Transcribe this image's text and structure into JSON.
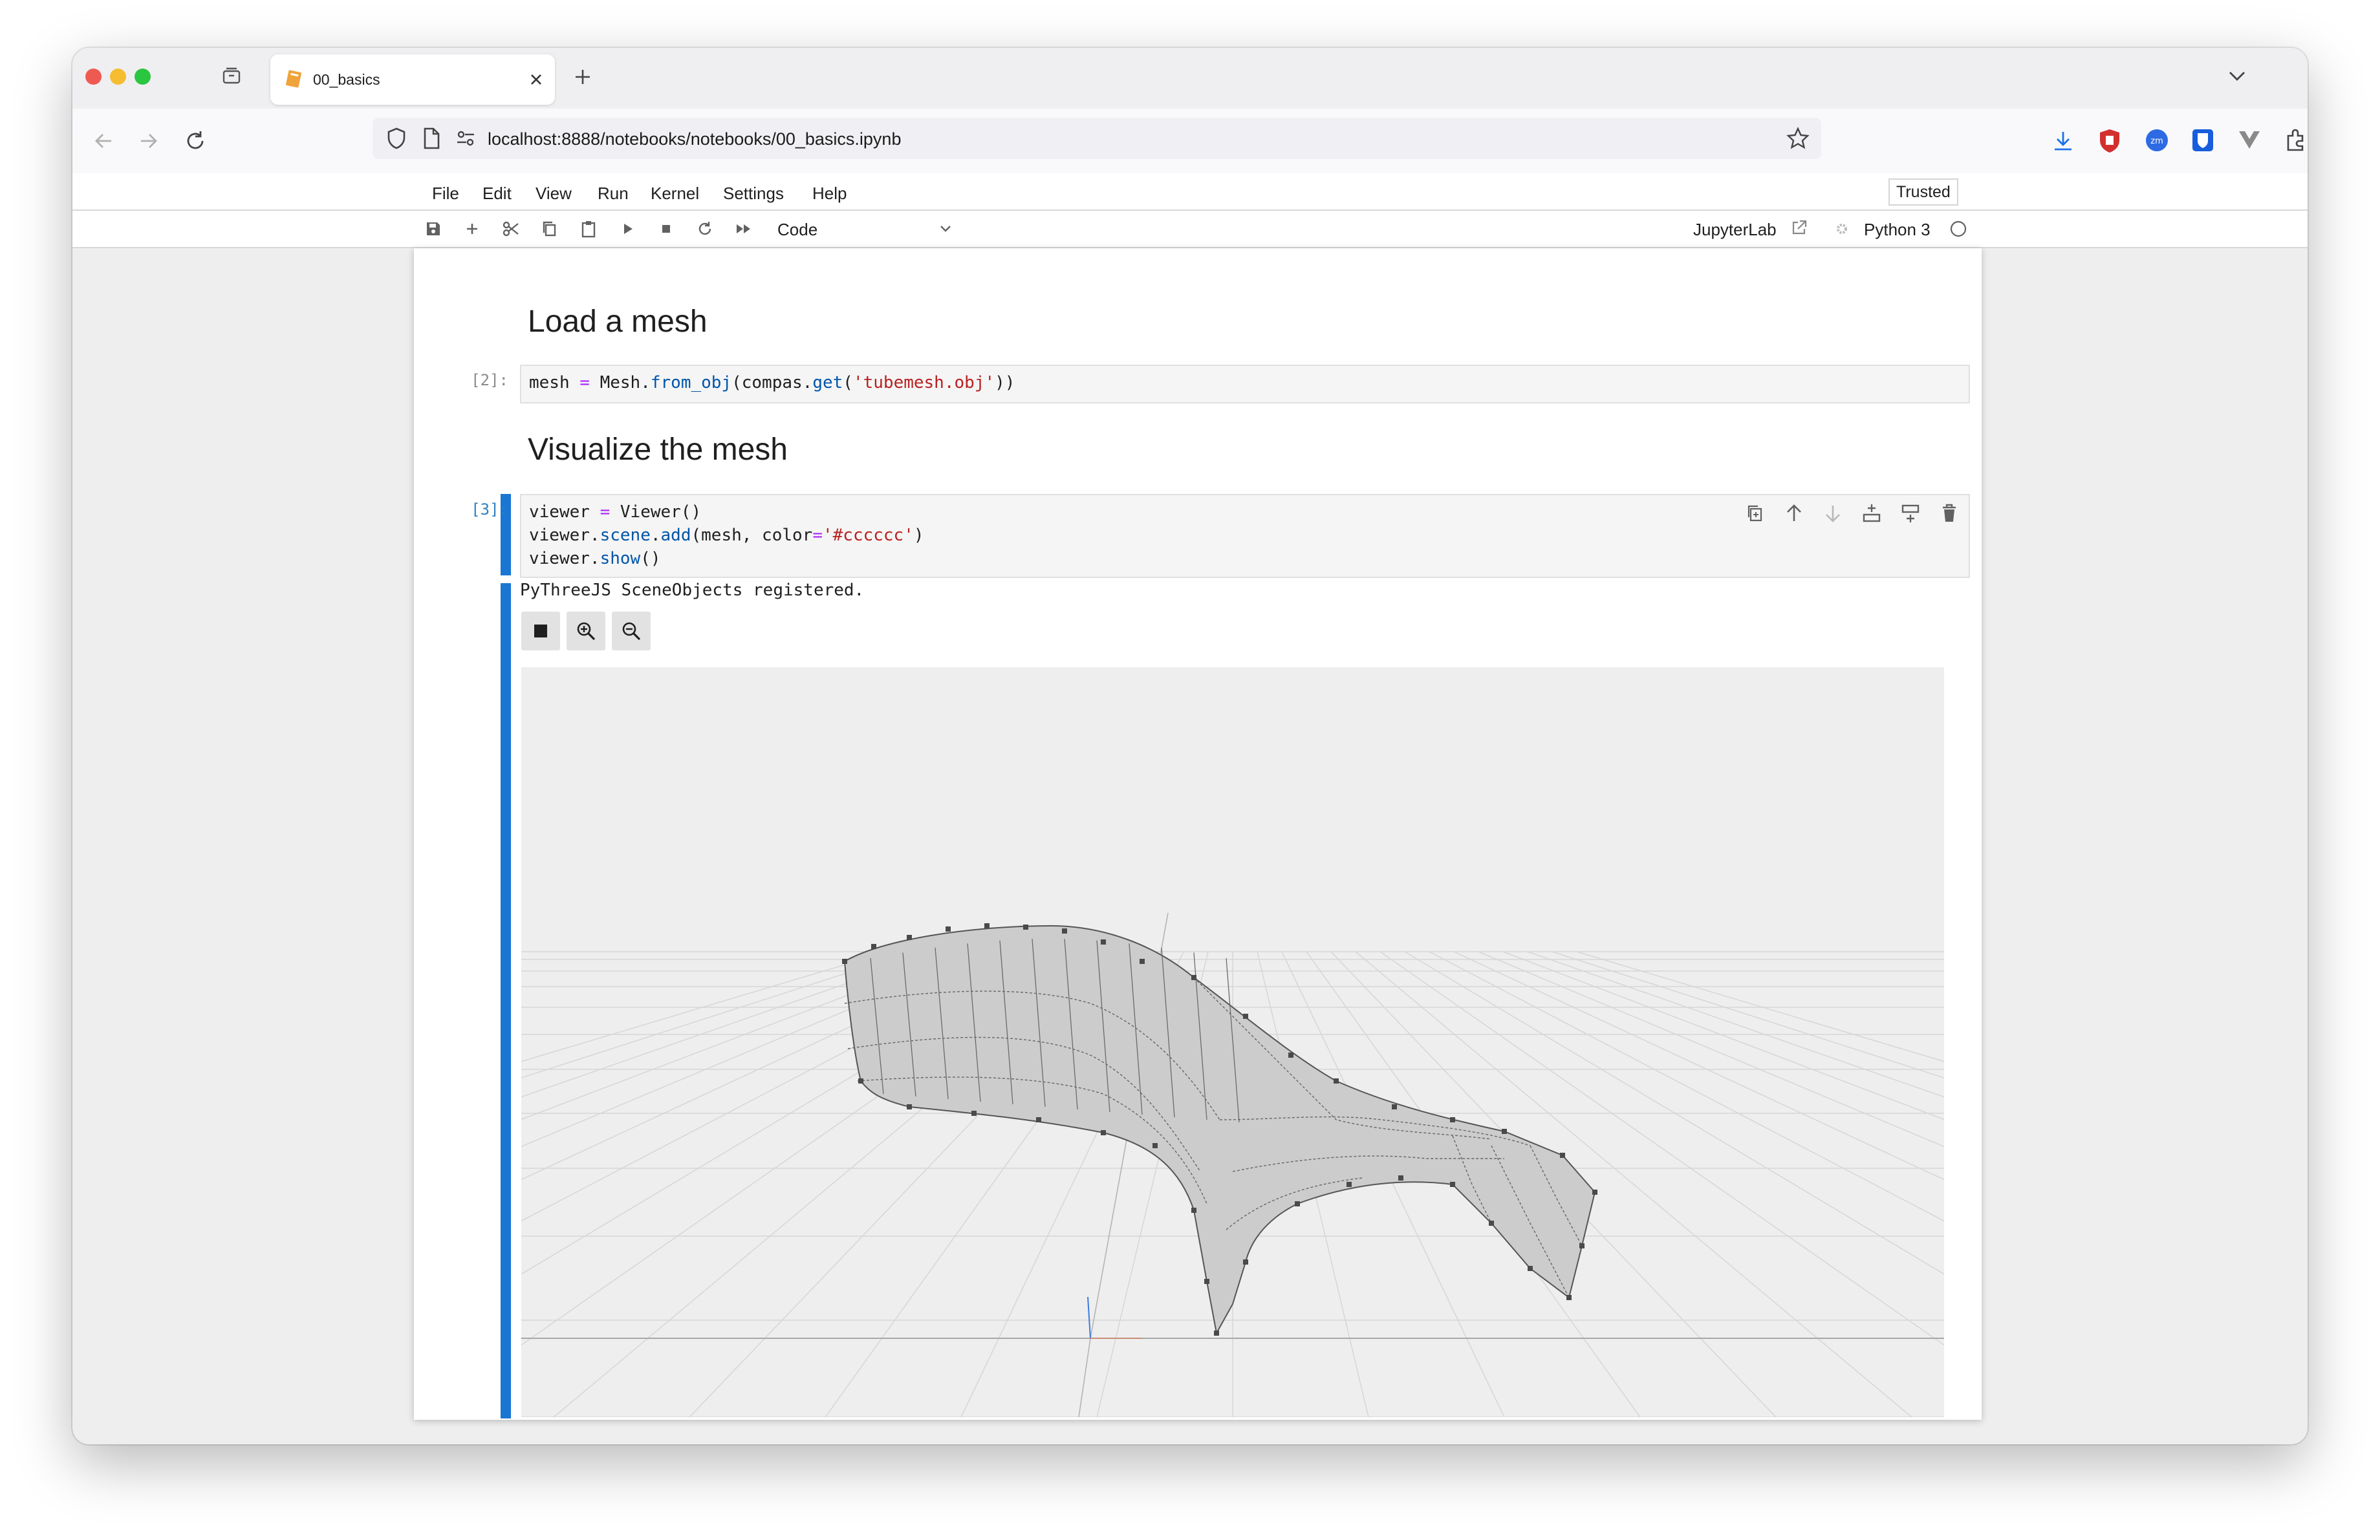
{
  "browser": {
    "tab_title": "00_basics",
    "url": "localhost:8888/notebooks/notebooks/00_basics.ipynb"
  },
  "menubar": {
    "items": [
      "File",
      "Edit",
      "View",
      "Run",
      "Kernel",
      "Settings",
      "Help"
    ],
    "trusted_label": "Trusted"
  },
  "toolbar": {
    "cell_type": "Code",
    "jupyterlab_label": "JupyterLab",
    "kernel_name": "Python 3"
  },
  "cells": {
    "heading1": "Load a mesh",
    "cell2_prompt": "[2]:",
    "heading2": "Visualize the mesh",
    "cell3_prompt": "[3]:",
    "cell3_output": "PyThreeJS SceneObjects registered."
  },
  "icons": {
    "viewer_buttons": [
      "stop-icon",
      "zoom-in-icon",
      "zoom-out-icon"
    ],
    "cell_toolbar": [
      "duplicate-icon",
      "move-up-icon",
      "move-down-icon",
      "insert-above-icon",
      "insert-below-icon",
      "delete-icon"
    ]
  },
  "colors": {
    "accent_blue": "#1976d2",
    "mesh_color": "#cccccc"
  }
}
